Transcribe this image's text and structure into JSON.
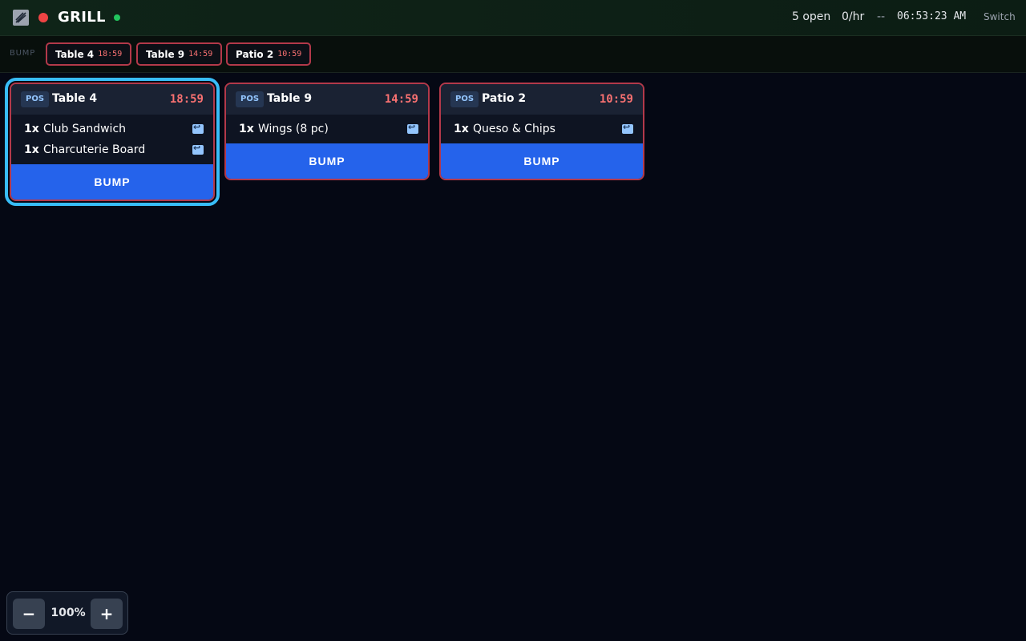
{
  "header": {
    "station": "GRILL",
    "open_count": "5 open",
    "rate": "0/hr",
    "dash": "--",
    "clock": "06:53:23 AM",
    "switch_label": "Switch"
  },
  "bumpbar": {
    "label": "BUMP",
    "chips": [
      {
        "name": "Table 4",
        "time": "18:59"
      },
      {
        "name": "Table 9",
        "time": "14:59"
      },
      {
        "name": "Patio 2",
        "time": "10:59"
      }
    ]
  },
  "tickets": [
    {
      "source": "POS",
      "title": "Table 4",
      "timer": "18:59",
      "items": [
        {
          "qty": "1x",
          "name": "Club Sandwich"
        },
        {
          "qty": "1x",
          "name": "Charcuterie Board"
        }
      ],
      "bump_label": "BUMP"
    },
    {
      "source": "POS",
      "title": "Table 9",
      "timer": "14:59",
      "items": [
        {
          "qty": "1x",
          "name": "Wings (8 pc)"
        }
      ],
      "bump_label": "BUMP"
    },
    {
      "source": "POS",
      "title": "Patio 2",
      "timer": "10:59",
      "items": [
        {
          "qty": "1x",
          "name": "Queso & Chips"
        }
      ],
      "bump_label": "BUMP"
    }
  ],
  "zoom": {
    "minus": "−",
    "level": "100%",
    "plus": "+"
  },
  "colors": {
    "accent": "#2563eb",
    "overdue": "#f87171",
    "selected": "#38bdf8",
    "status_online": "#22c55e",
    "status_recording": "#ef4444"
  },
  "icons": {
    "logo": "station-logo-icon",
    "item_action": "recall-icon"
  }
}
